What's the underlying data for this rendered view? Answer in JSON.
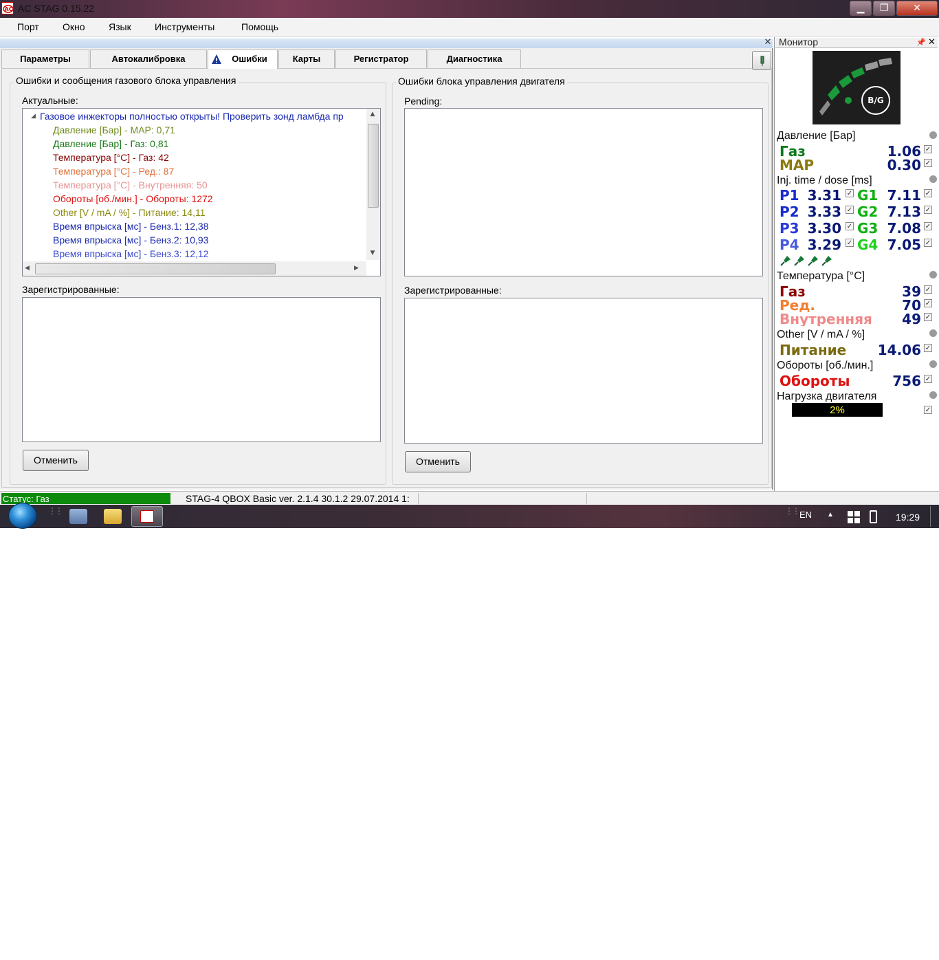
{
  "window": {
    "title": "AC STAG 0.15.22"
  },
  "menu": [
    "Порт",
    "Окно",
    "Язык",
    "Инструменты",
    "Помощь"
  ],
  "tabs": [
    "Параметры",
    "Автокалибровка",
    "Ошибки",
    "Карты",
    "Регистратор",
    "Диагностика"
  ],
  "active_tab": "Ошибки",
  "gas_errors": {
    "title": "Ошибки и сообщения газового блока управления",
    "actual_label": "Актуальные:",
    "root_item": "Газовое инжекторы полностью открыты! Проверить зонд ламбда пр",
    "items": [
      {
        "text": "Давление [Бар] - MAP: 0,71",
        "color": "#6e8a1a"
      },
      {
        "text": "Давление [Бар] - Газ: 0,81",
        "color": "#1a7a1a"
      },
      {
        "text": "Температура [°C] - Газ: 42",
        "color": "#8b0000"
      },
      {
        "text": "Температура [°C] - Ред.: 87",
        "color": "#e0703a"
      },
      {
        "text": "Температура [°C] - Внутренняя: 50",
        "color": "#e89090"
      },
      {
        "text": "Обороты [об./мин.] - Обороты: 1272",
        "color": "#e01010"
      },
      {
        "text": "Other [V / mA / %] - Питание: 14,11",
        "color": "#8a8a10"
      },
      {
        "text": "Время впрыска [мс] - Бенз.1: 12,38",
        "color": "#1a2ab0"
      },
      {
        "text": "Время впрыска [мс] - Бенз.2: 10,93",
        "color": "#1a2ab0"
      },
      {
        "text": "Время впрыска [мс] - Бенз.3: 12,12",
        "color": "#3a4ad0"
      }
    ],
    "registered_label": "Зарегистрированные:",
    "cancel_label": "Отменить"
  },
  "engine_errors": {
    "title": "Ошибки блока управления двигателя",
    "pending_label": "Pending:",
    "registered_label": "Зарегистрированные:",
    "cancel_label": "Отменить"
  },
  "status": {
    "left": "Статус: Газ",
    "info": "STAG-4 QBOX Basic  ver. 2.1.4  30.1.2   29.07.2014 1:"
  },
  "taskbar": {
    "lang": "EN",
    "time": "19:29"
  },
  "monitor": {
    "title": "Монитор",
    "logo_text": "B/G",
    "pressure": {
      "header": "Давление [Бар]",
      "gas_label": "Газ",
      "gas_value": "1.06",
      "map_label": "MAP",
      "map_value": "0.30"
    },
    "inj": {
      "header": "Inj. time / dose [ms]",
      "rows": [
        {
          "p": "P1",
          "pv": "3.31",
          "g": "G1",
          "gv": "7.11"
        },
        {
          "p": "P2",
          "pv": "3.33",
          "g": "G2",
          "gv": "7.13"
        },
        {
          "p": "P3",
          "pv": "3.30",
          "g": "G3",
          "gv": "7.08"
        },
        {
          "p": "P4",
          "pv": "3.29",
          "g": "G4",
          "gv": "7.05"
        }
      ]
    },
    "temperature": {
      "header": "Температура [°C]",
      "gas_label": "Газ",
      "gas_value": "39",
      "red_label": "Ред.",
      "red_value": "70",
      "inner_label": "Внутренняя",
      "inner_value": "49"
    },
    "other": {
      "header": "Other [V / mA / %]",
      "power_label": "Питание",
      "power_value": "14.06"
    },
    "rpm": {
      "header": "Обороты [об./мин.]",
      "label": "Обороты",
      "value": "756"
    },
    "load": {
      "header": "Нагрузка двигателя",
      "value": "2%"
    }
  },
  "colors": {
    "gas_green": "#0a7a1a",
    "map_olive": "#8a7a10",
    "p_blue": "#1a2ad0",
    "g_green": "#10b010",
    "temp_gas": "#8b0000",
    "temp_red": "#f08030",
    "temp_inner": "#f08a8a",
    "power": "#7a6a10",
    "rpm": "#e01010"
  }
}
